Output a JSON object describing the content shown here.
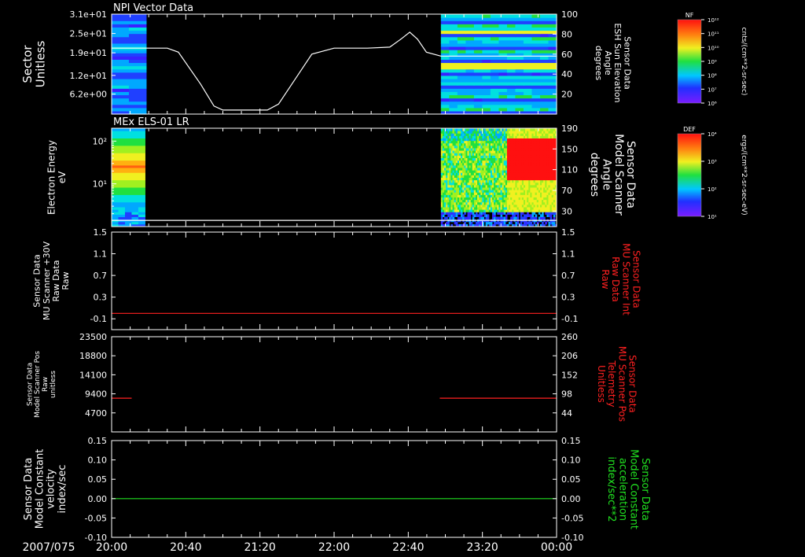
{
  "figure": {
    "date_label": "2007/075",
    "time_ticks": [
      "20:00",
      "20:40",
      "21:20",
      "22:00",
      "22:40",
      "23:20",
      "00:00"
    ]
  },
  "colorbars": [
    {
      "name": "NF",
      "unit": "cnts/(cm**2-sr-sec)",
      "tick_labels": [
        "10¹²",
        "10¹¹",
        "10¹⁰",
        "10⁹",
        "10⁸",
        "10⁷",
        "10⁶"
      ]
    },
    {
      "name": "DEF",
      "unit": "ergs/(cm**2-sr-sec-eV)",
      "tick_labels": [
        "10⁴",
        "10³",
        "10²",
        "10¹"
      ]
    }
  ],
  "chart_data": [
    {
      "type": "heatmap",
      "title": "NPI Vector Data",
      "ylabel": [
        "Sector",
        "Unitless"
      ],
      "y_tick_labels": [
        "3.1e+01",
        "2.5e+01",
        "1.9e+01",
        "1.2e+01",
        "6.2e+00"
      ],
      "ylim": [
        0,
        31
      ],
      "colorbar": "NF",
      "data_intervals_hours": [
        [
          20.0,
          20.31
        ],
        [
          22.96,
          24.0
        ]
      ],
      "overlay": {
        "type": "line",
        "ylabel": [
          "Sensor Data",
          "ESH Sun Elevation",
          "Angle",
          "degrees"
        ],
        "y_ticks": [
          20,
          40,
          60,
          80,
          100
        ],
        "ylim": [
          0,
          100
        ],
        "color": "#ffffff",
        "x_hours": [
          20.0,
          20.5,
          20.6,
          20.8,
          20.92,
          21.0,
          21.4,
          21.5,
          21.65,
          21.8,
          22.0,
          22.3,
          22.5,
          22.6,
          22.68,
          22.75,
          22.83,
          22.96,
          23.2,
          24.0
        ],
        "y": [
          66,
          66,
          62,
          30,
          8,
          4,
          4,
          10,
          35,
          60,
          66,
          66,
          67,
          75,
          82,
          75,
          62,
          58,
          58,
          58
        ]
      }
    },
    {
      "type": "heatmap",
      "title": "MEx ELS-01 LR",
      "ylabel": [
        "Electron Energy",
        "eV"
      ],
      "y_tick_labels": [
        "10²",
        "10¹"
      ],
      "ylim": [
        1,
        200
      ],
      "colorbar": "DEF",
      "data_intervals_hours": [
        [
          20.0,
          20.3
        ],
        [
          22.96,
          24.0
        ]
      ],
      "overlay": {
        "type": "line",
        "ylabel": [
          "Sensor Data",
          "Model Scanner",
          "Angle",
          "degrees"
        ],
        "y_ticks": [
          30,
          70,
          110,
          150,
          190
        ],
        "ylim": [
          0,
          190
        ],
        "color": "#ffffff",
        "x_hours": [
          20.0,
          24.0
        ],
        "y": [
          12,
          12
        ]
      }
    },
    {
      "type": "line",
      "ylabel": [
        "Sensor Data",
        "MU Scanner +30V",
        "Raw Data",
        "Raw"
      ],
      "y_ticks": [
        -0.1,
        0.3,
        0.7,
        1.1,
        1.5
      ],
      "y_tick_labels": [
        "-0.1",
        "0.3",
        "0.7",
        "1.1",
        "1.5"
      ],
      "ylim": [
        -0.3,
        1.5
      ],
      "right_axis": {
        "ylabel": [
          "Sensor Data",
          "MU Scanner Int",
          "Raw Data",
          "Raw"
        ],
        "y_tick_labels": [
          "-0.1",
          "0.3",
          "0.7",
          "1.1",
          "1.5"
        ],
        "color": "#ff2020"
      },
      "series": [
        {
          "color": "#ff2020",
          "x_hours": [
            20.0,
            24.0
          ],
          "y": [
            0.0,
            0.0
          ]
        }
      ]
    },
    {
      "type": "line",
      "ylabel": [
        "Sensor Data",
        "Model Scanner Pos",
        "Raw",
        "unitless"
      ],
      "y_ticks": [
        4700,
        9400,
        14100,
        18800,
        23500
      ],
      "y_tick_labels": [
        "4700",
        "9400",
        "14100",
        "18800",
        "23500"
      ],
      "ylim": [
        0,
        23500
      ],
      "right_axis": {
        "ylabel": [
          "Sensor Data",
          "MU Scanner Pos",
          "Telemetry",
          "Unitless"
        ],
        "y_tick_labels": [
          "44",
          "98",
          "152",
          "206",
          "260"
        ],
        "color": "#ff2020"
      },
      "series": [
        {
          "color": "#ff2020",
          "x_hours": [
            20.0,
            20.18
          ],
          "y": [
            8330,
            8330
          ]
        },
        {
          "color": "#ff2020",
          "x_hours": [
            22.95,
            24.0
          ],
          "y": [
            8330,
            8330
          ]
        }
      ]
    },
    {
      "type": "line",
      "ylabel": [
        "Sensor Data",
        "Model Constant",
        "velocity",
        "index/sec"
      ],
      "y_ticks": [
        -0.1,
        -0.05,
        0.0,
        0.05,
        0.1,
        0.15
      ],
      "y_tick_labels": [
        "-0.10",
        "-0.05",
        "0.00",
        "0.05",
        "0.10",
        "0.15"
      ],
      "ylim": [
        -0.1,
        0.15
      ],
      "right_axis": {
        "ylabel": [
          "Sensor Data",
          "Model Constant",
          "acceleration",
          "index/sec**2"
        ],
        "y_tick_labels": [
          "-0.10",
          "-0.05",
          "0.00",
          "0.05",
          "0.10",
          "0.15"
        ],
        "color": "#20e020"
      },
      "series": [
        {
          "color": "#20e020",
          "x_hours": [
            20.0,
            24.0
          ],
          "y": [
            0.0,
            0.0
          ]
        }
      ]
    }
  ]
}
